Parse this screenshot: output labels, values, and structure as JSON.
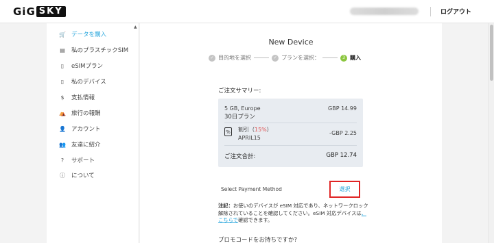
{
  "header": {
    "logo_left": "GiG",
    "logo_right": "SKY",
    "logout": "ログアウト"
  },
  "sidebar": {
    "items": [
      {
        "label": "データを購入",
        "icon": "cart-icon",
        "glyph": "🛒"
      },
      {
        "label": "私のプラスチックSIM",
        "icon": "sim-card-icon",
        "glyph": "▤"
      },
      {
        "label": "eSIMプラン",
        "icon": "phone-icon",
        "glyph": "▯"
      },
      {
        "label": "私のデバイス",
        "icon": "device-icon",
        "glyph": "▯"
      },
      {
        "label": "支払情報",
        "icon": "dollar-icon",
        "glyph": "$"
      },
      {
        "label": "旅行の報酬",
        "icon": "reward-icon",
        "glyph": "⛺"
      },
      {
        "label": "アカウント",
        "icon": "user-icon",
        "glyph": "👤"
      },
      {
        "label": "友達に紹介",
        "icon": "friends-icon",
        "glyph": "👥"
      },
      {
        "label": "サポート",
        "icon": "question-icon",
        "glyph": "?"
      },
      {
        "label": "について",
        "icon": "info-icon",
        "glyph": "ⓘ"
      }
    ]
  },
  "main": {
    "title": "New Device",
    "steps": [
      {
        "label": "目的地を選択",
        "glyph": "✓"
      },
      {
        "label": "プランを選択：",
        "glyph": "✓"
      },
      {
        "number": "3",
        "label": "購入"
      }
    ],
    "summary": {
      "title": "ご注文サマリー:",
      "plan_name": "5 GB, Europe",
      "plan_duration": "30日プラン",
      "plan_price": "GBP 14.99",
      "discount_icon": "%",
      "discount_label": "割引（",
      "discount_pct": "15%",
      "discount_close": "）",
      "discount_code": "APRIL15",
      "discount_value": "-GBP 2.25",
      "total_label": "ご注文合計:",
      "total_value": "GBP 12.74"
    },
    "payment": {
      "label": "Select Payment Method",
      "button": "選択"
    },
    "note": {
      "prefix": "注記：",
      "text": "お使いのデバイスが eSIM 対応であり、ネットワークロック解除されていることを確認してください。eSIM 対応デバイスは",
      "link": "、こちらで",
      "suffix": "確認できます。"
    },
    "promo": "プロモコードをお持ちですか?"
  },
  "colors": {
    "accent": "#2aa7dd",
    "step_active": "#8bc63f",
    "highlight_border": "#e02424",
    "summary_bg": "#e8ecf1"
  }
}
